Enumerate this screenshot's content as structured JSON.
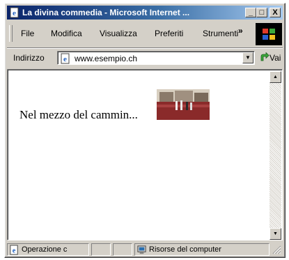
{
  "window": {
    "title": "La divina commedia - Microsoft Internet ...",
    "controls": {
      "minimize": "_",
      "maximize": "□",
      "close": "X"
    }
  },
  "menu": {
    "items": [
      "File",
      "Modifica",
      "Visualizza",
      "Preferiti",
      "Strumenti"
    ],
    "overflow": "»"
  },
  "address": {
    "label": "Indirizzo",
    "url": "www.esempio.ch",
    "go_label": "Vai"
  },
  "page": {
    "text": "Nel mezzo del cammin..."
  },
  "statusbar": {
    "status": "Operazione c",
    "zone": "Risorse del computer"
  },
  "icons": {
    "window": "ie-page-icon",
    "throbber": "windows-logo-icon",
    "address": "ie-page-icon",
    "go": "go-arrow-icon",
    "status": "ie-page-icon",
    "zone": "my-computer-icon"
  },
  "colors": {
    "titlebar_start": "#0a246a",
    "titlebar_end": "#a6caf0",
    "chrome": "#d4d0c8"
  }
}
